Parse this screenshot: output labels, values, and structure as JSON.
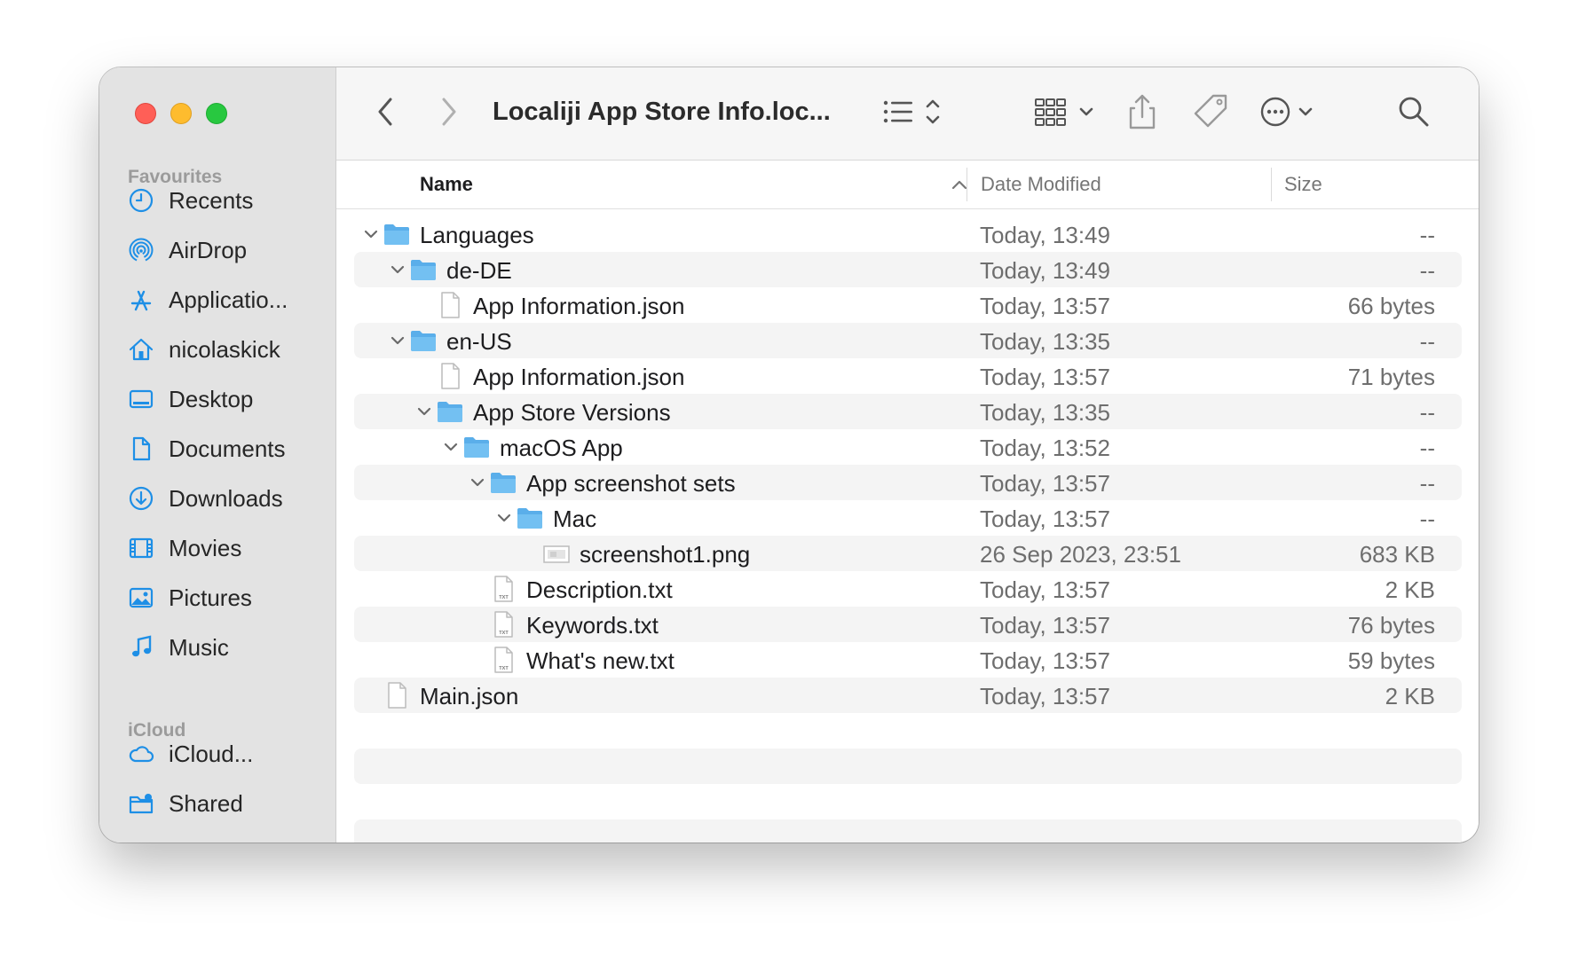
{
  "window": {
    "title": "Localiji App Store Info.loc..."
  },
  "sidebar": {
    "favourites_title": "Favourites",
    "favourites": [
      {
        "label": "Recents",
        "icon": "clock-icon"
      },
      {
        "label": "AirDrop",
        "icon": "airdrop-icon"
      },
      {
        "label": "Applicatio...",
        "icon": "applications-icon"
      },
      {
        "label": "nicolaskick",
        "icon": "home-icon"
      },
      {
        "label": "Desktop",
        "icon": "desktop-icon"
      },
      {
        "label": "Documents",
        "icon": "document-icon"
      },
      {
        "label": "Downloads",
        "icon": "downloads-icon"
      },
      {
        "label": "Movies",
        "icon": "film-icon"
      },
      {
        "label": "Pictures",
        "icon": "photo-icon"
      },
      {
        "label": "Music",
        "icon": "music-note-icon"
      }
    ],
    "icloud_title": "iCloud",
    "icloud": [
      {
        "label": "iCloud...",
        "icon": "cloud-icon"
      },
      {
        "label": "Shared",
        "icon": "shared-folder-icon"
      }
    ]
  },
  "columns": {
    "name": "Name",
    "date": "Date Modified",
    "size": "Size"
  },
  "files": [
    {
      "name": "Languages",
      "date": "Today, 13:49",
      "size": "--",
      "type": "folder",
      "level": 0,
      "expanded": true
    },
    {
      "name": "de-DE",
      "date": "Today, 13:49",
      "size": "--",
      "type": "folder",
      "level": 1,
      "expanded": true
    },
    {
      "name": "App Information.json",
      "date": "Today, 13:57",
      "size": "66 bytes",
      "type": "file",
      "level": 2
    },
    {
      "name": "en-US",
      "date": "Today, 13:35",
      "size": "--",
      "type": "folder",
      "level": 1,
      "expanded": true
    },
    {
      "name": "App Information.json",
      "date": "Today, 13:57",
      "size": "71 bytes",
      "type": "file",
      "level": 2
    },
    {
      "name": "App Store Versions",
      "date": "Today, 13:35",
      "size": "--",
      "type": "folder",
      "level": 2,
      "expanded": true
    },
    {
      "name": "macOS App",
      "date": "Today, 13:52",
      "size": "--",
      "type": "folder",
      "level": 3,
      "expanded": true
    },
    {
      "name": "App screenshot sets",
      "date": "Today, 13:57",
      "size": "--",
      "type": "folder",
      "level": 4,
      "expanded": true
    },
    {
      "name": "Mac",
      "date": "Today, 13:57",
      "size": "--",
      "type": "folder",
      "level": 5,
      "expanded": true
    },
    {
      "name": "screenshot1.png",
      "date": "26 Sep 2023, 23:51",
      "size": "683 KB",
      "type": "image",
      "level": 6
    },
    {
      "name": "Description.txt",
      "date": "Today, 13:57",
      "size": "2 KB",
      "type": "txt",
      "level": 4
    },
    {
      "name": "Keywords.txt",
      "date": "Today, 13:57",
      "size": "76 bytes",
      "type": "txt",
      "level": 4
    },
    {
      "name": "What's new.txt",
      "date": "Today, 13:57",
      "size": "59 bytes",
      "type": "txt",
      "level": 4
    },
    {
      "name": "Main.json",
      "date": "Today, 13:57",
      "size": "2 KB",
      "type": "file",
      "level": 0
    }
  ],
  "colors": {
    "accent": "#1e8fe6",
    "folder": "#6cb8f0",
    "close": "#ff5f57",
    "minimize": "#febc2e",
    "zoom": "#28c840"
  }
}
